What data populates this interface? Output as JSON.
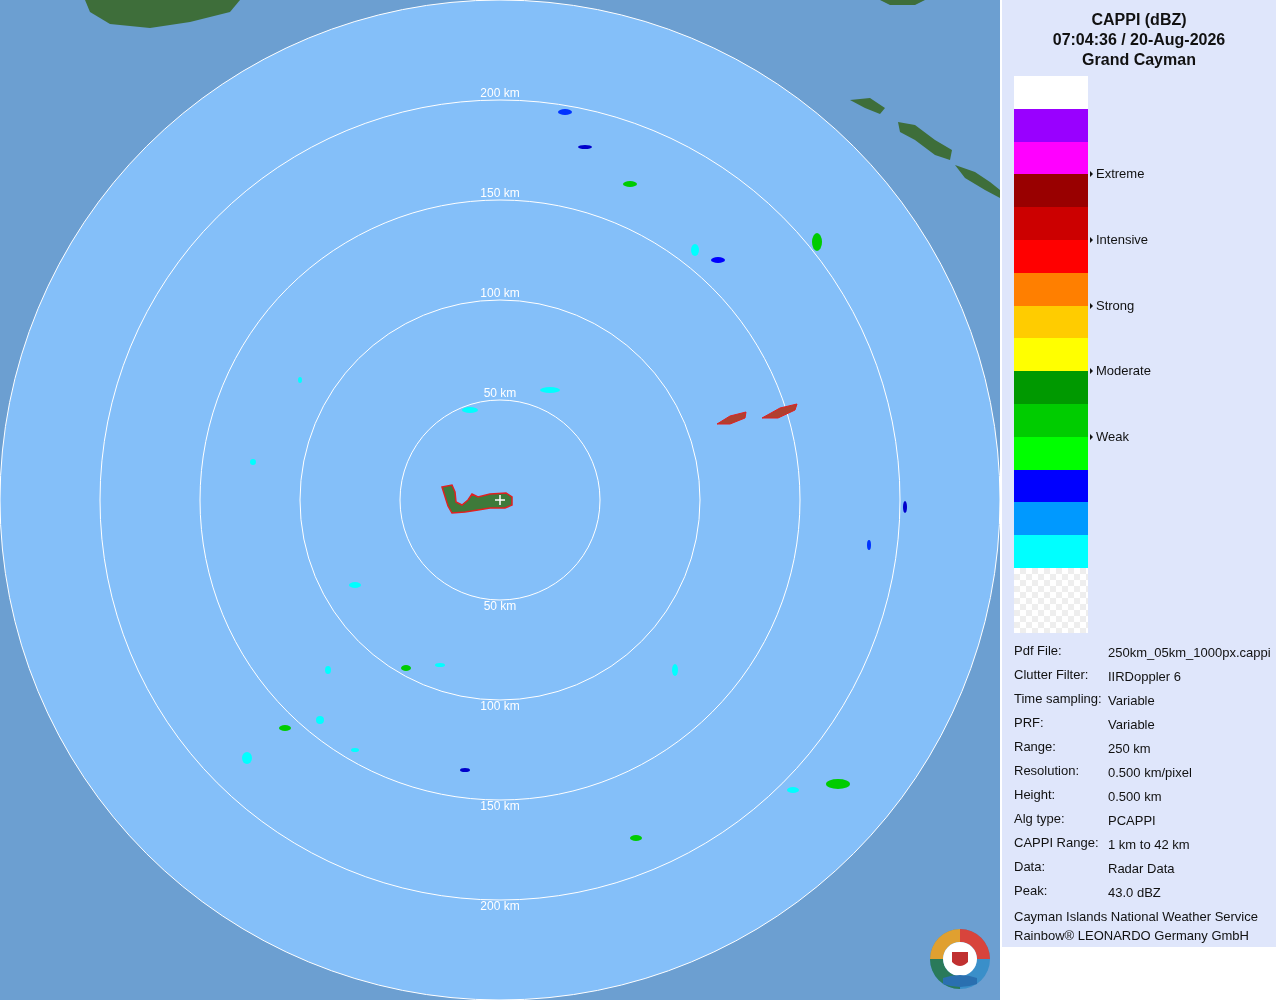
{
  "map": {
    "rings_top": [
      "200 km",
      "150 km",
      "100 km",
      "50 km"
    ],
    "rings_bottom": [
      "50 km",
      "100 km",
      "150 km",
      "200 km"
    ]
  },
  "legend": {
    "title": [
      "CAPPI (dBZ)",
      "07:04:36 / 20-Aug-2026",
      "Grand Cayman"
    ],
    "bands": [
      {
        "kind": "solid",
        "color": "#ffffff"
      },
      {
        "kind": "solid",
        "color": "#9900ff"
      },
      {
        "kind": "solid",
        "color": "#ff00ff"
      },
      {
        "kind": "solid",
        "color": "#990000",
        "label": "Extreme"
      },
      {
        "kind": "solid",
        "color": "#cc0000"
      },
      {
        "kind": "solid",
        "color": "#ff0000",
        "label": "Intensive"
      },
      {
        "kind": "solid",
        "color": "#ff7f00"
      },
      {
        "kind": "solid",
        "color": "#ffcc00",
        "label": "Strong"
      },
      {
        "kind": "solid",
        "color": "#ffff00"
      },
      {
        "kind": "solid",
        "color": "#009900",
        "label": "Moderate"
      },
      {
        "kind": "solid",
        "color": "#00cc00"
      },
      {
        "kind": "solid",
        "color": "#00ff00",
        "label": "Weak"
      },
      {
        "kind": "solid",
        "color": "#0000ff"
      },
      {
        "kind": "solid",
        "color": "#0099ff"
      },
      {
        "kind": "solid",
        "color": "#00ffff"
      },
      {
        "kind": "transparent"
      }
    ]
  },
  "info": [
    {
      "label": "Pdf File:",
      "value": "250km_05km_1000px.cappi"
    },
    {
      "label": "Clutter Filter:",
      "value": "IIRDoppler 6"
    },
    {
      "label": "Time sampling:",
      "value": "Variable"
    },
    {
      "label": "PRF:",
      "value": "Variable"
    },
    {
      "label": "Range:",
      "value": "250 km"
    },
    {
      "label": "Resolution:",
      "value": "0.500 km/pixel"
    },
    {
      "label": "Height:",
      "value": "0.500 km"
    },
    {
      "label": "Alg type:",
      "value": "PCAPPI"
    },
    {
      "label": "CAPPI Range:",
      "value": "1 km to 42 km"
    },
    {
      "label": "Data:",
      "value": "Radar Data"
    },
    {
      "label": "Peak:",
      "value": "43.0 dBZ"
    }
  ],
  "credits": [
    "Cayman Islands National Weather Service",
    "Rainbow® LEONARDO Germany GmbH"
  ]
}
